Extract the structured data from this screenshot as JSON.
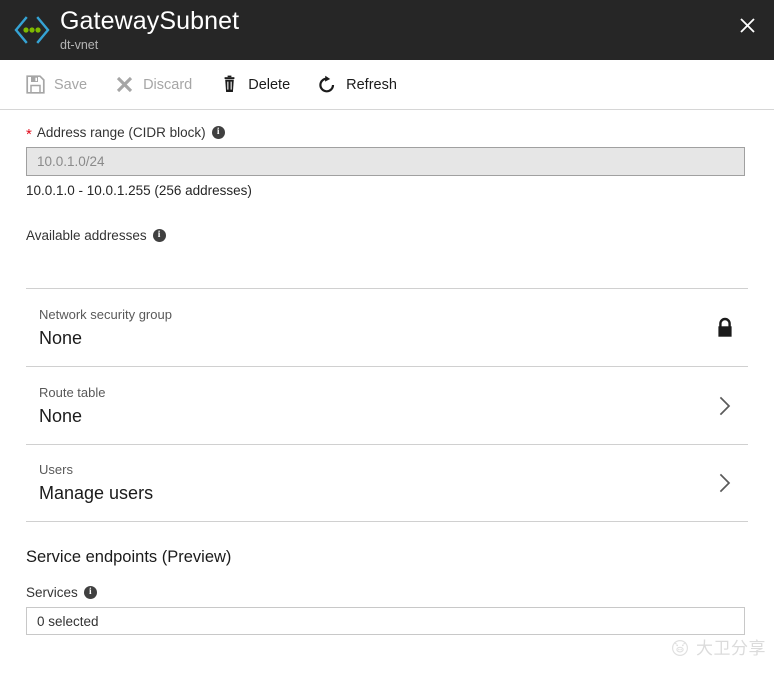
{
  "header": {
    "icon": "subnet-icon",
    "title": "GatewaySubnet",
    "subtitle": "dt-vnet",
    "close_label": "✕",
    "background_color": "#262626",
    "icon_bracket_color": "#35a3d4",
    "icon_dot_color": "#7fba00"
  },
  "toolbar": {
    "items": [
      {
        "label": "Save",
        "icon": "save-icon",
        "disabled": true
      },
      {
        "label": "Discard",
        "icon": "discard-icon",
        "disabled": true
      },
      {
        "label": "Delete",
        "icon": "delete-icon",
        "disabled": false
      },
      {
        "label": "Refresh",
        "icon": "refresh-icon",
        "disabled": false
      }
    ]
  },
  "address_range": {
    "label": "Address range (CIDR block)",
    "required": true,
    "required_marker": "*",
    "info_icon": "info-icon",
    "value": "10.0.1.0/24",
    "placeholder": "10.0.1.0/24",
    "disabled": true,
    "help_text": "10.0.1.0 - 10.0.1.255 (256 addresses)"
  },
  "available_addresses": {
    "label": "Available addresses",
    "info_icon": "info-icon",
    "value": ""
  },
  "properties": [
    {
      "name": "Network security group",
      "value": "None",
      "affordance": "lock-icon"
    },
    {
      "name": "Route table",
      "value": "None",
      "affordance": "chevron-right-icon"
    },
    {
      "name": "Users",
      "value": "Manage users",
      "affordance": "chevron-right-icon"
    }
  ],
  "service_endpoints": {
    "title": "Service endpoints (Preview)",
    "services_label": "Services",
    "info_icon": "info-icon",
    "selected_text": "0 selected"
  },
  "watermark": {
    "text": "大卫分享",
    "logo": "pig-logo-icon"
  }
}
